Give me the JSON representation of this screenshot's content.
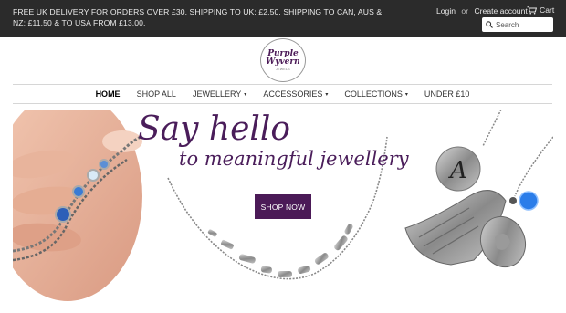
{
  "topbar": {
    "announcement": "FREE UK DELIVERY FOR ORDERS OVER £30. SHIPPING TO UK: £2.50. SHIPPING TO CAN, AUS & NZ: £11.50 & TO USA FROM £13.00.",
    "login": "Login",
    "or": "or",
    "create_account": "Create account",
    "cart": "Cart",
    "search_placeholder": "Search"
  },
  "logo": {
    "line1": "Purple",
    "line2": "Wyvern",
    "line3": "JEWELS"
  },
  "nav": {
    "items": [
      {
        "label": "HOME"
      },
      {
        "label": "SHOP ALL"
      },
      {
        "label": "JEWELLERY",
        "caret": "▾"
      },
      {
        "label": "ACCESSORIES",
        "caret": "▾"
      },
      {
        "label": "COLLECTIONS",
        "caret": "▾"
      },
      {
        "label": "UNDER £10"
      }
    ]
  },
  "hero": {
    "title": "Say hello",
    "subtitle": "to meaningful jewellery",
    "cta": "SHOP NOW",
    "charm_letter": "A"
  },
  "colors": {
    "topbar": "#2b2b2b",
    "brand_purple": "#4b1a57",
    "nav_border": "#d6d6d6"
  }
}
